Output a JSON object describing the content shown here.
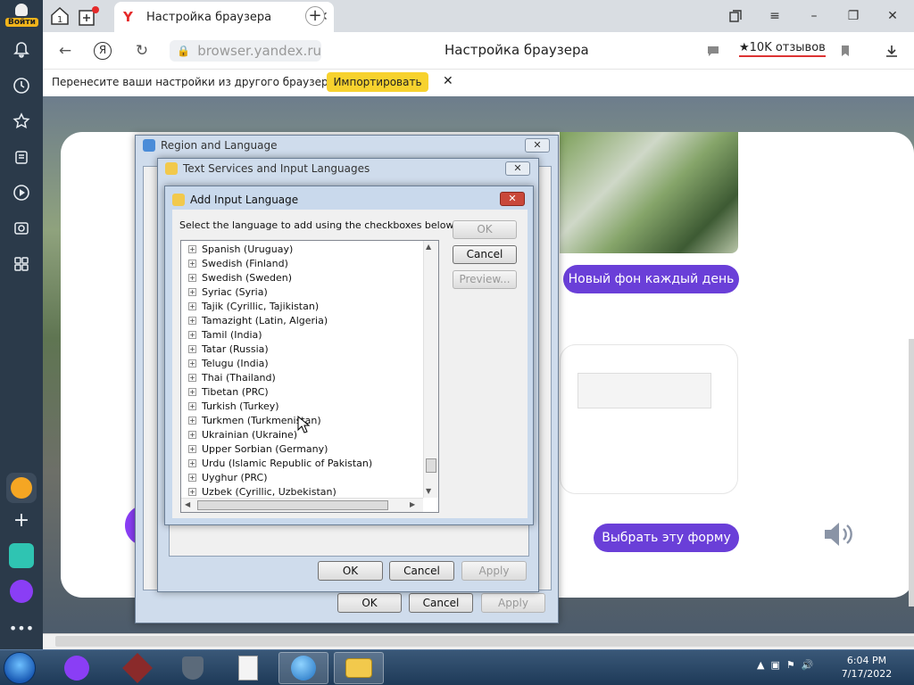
{
  "sidebar": {
    "login_label": "Войти"
  },
  "tabs": {
    "active_title": "Настройка браузера",
    "favicon": "Y"
  },
  "addressbar": {
    "url": "browser.yandex.ru",
    "page_title": "Настройка браузера",
    "reviews": "★10K отзывов"
  },
  "infobar": {
    "message": "Перенесите ваши настройки из другого браузера.",
    "import_label": "Импортировать",
    "close": "✕"
  },
  "page": {
    "new_bg_button": "Новый фон каждый день",
    "choose_form_button": "Выбрать эту форму"
  },
  "dialogs": {
    "region": {
      "title": "Region and Language",
      "ok": "OK",
      "cancel": "Cancel",
      "apply": "Apply"
    },
    "text_services": {
      "title": "Text Services and Input Languages",
      "ok": "OK",
      "cancel": "Cancel",
      "apply": "Apply"
    },
    "add_input": {
      "title": "Add Input Language",
      "instruction": "Select the language to add using the checkboxes below.",
      "ok": "OK",
      "cancel": "Cancel",
      "preview": "Preview...",
      "languages": [
        "Spanish (Uruguay)",
        "Swedish (Finland)",
        "Swedish (Sweden)",
        "Syriac (Syria)",
        "Tajik (Cyrillic, Tajikistan)",
        "Tamazight (Latin, Algeria)",
        "Tamil (India)",
        "Tatar (Russia)",
        "Telugu (India)",
        "Thai (Thailand)",
        "Tibetan (PRC)",
        "Turkish (Turkey)",
        "Turkmen (Turkmenistan)",
        "Ukrainian (Ukraine)",
        "Upper Sorbian (Germany)",
        "Urdu (Islamic Republic of Pakistan)",
        "Uyghur (PRC)",
        "Uzbek (Cyrillic, Uzbekistan)"
      ]
    }
  },
  "taskbar": {
    "time": "6:04 PM",
    "date": "7/17/2022"
  },
  "colors": {
    "accent_purple": "#6a3fd8",
    "import_yellow": "#f7d22e",
    "sidebar": "#2b3a4a"
  }
}
